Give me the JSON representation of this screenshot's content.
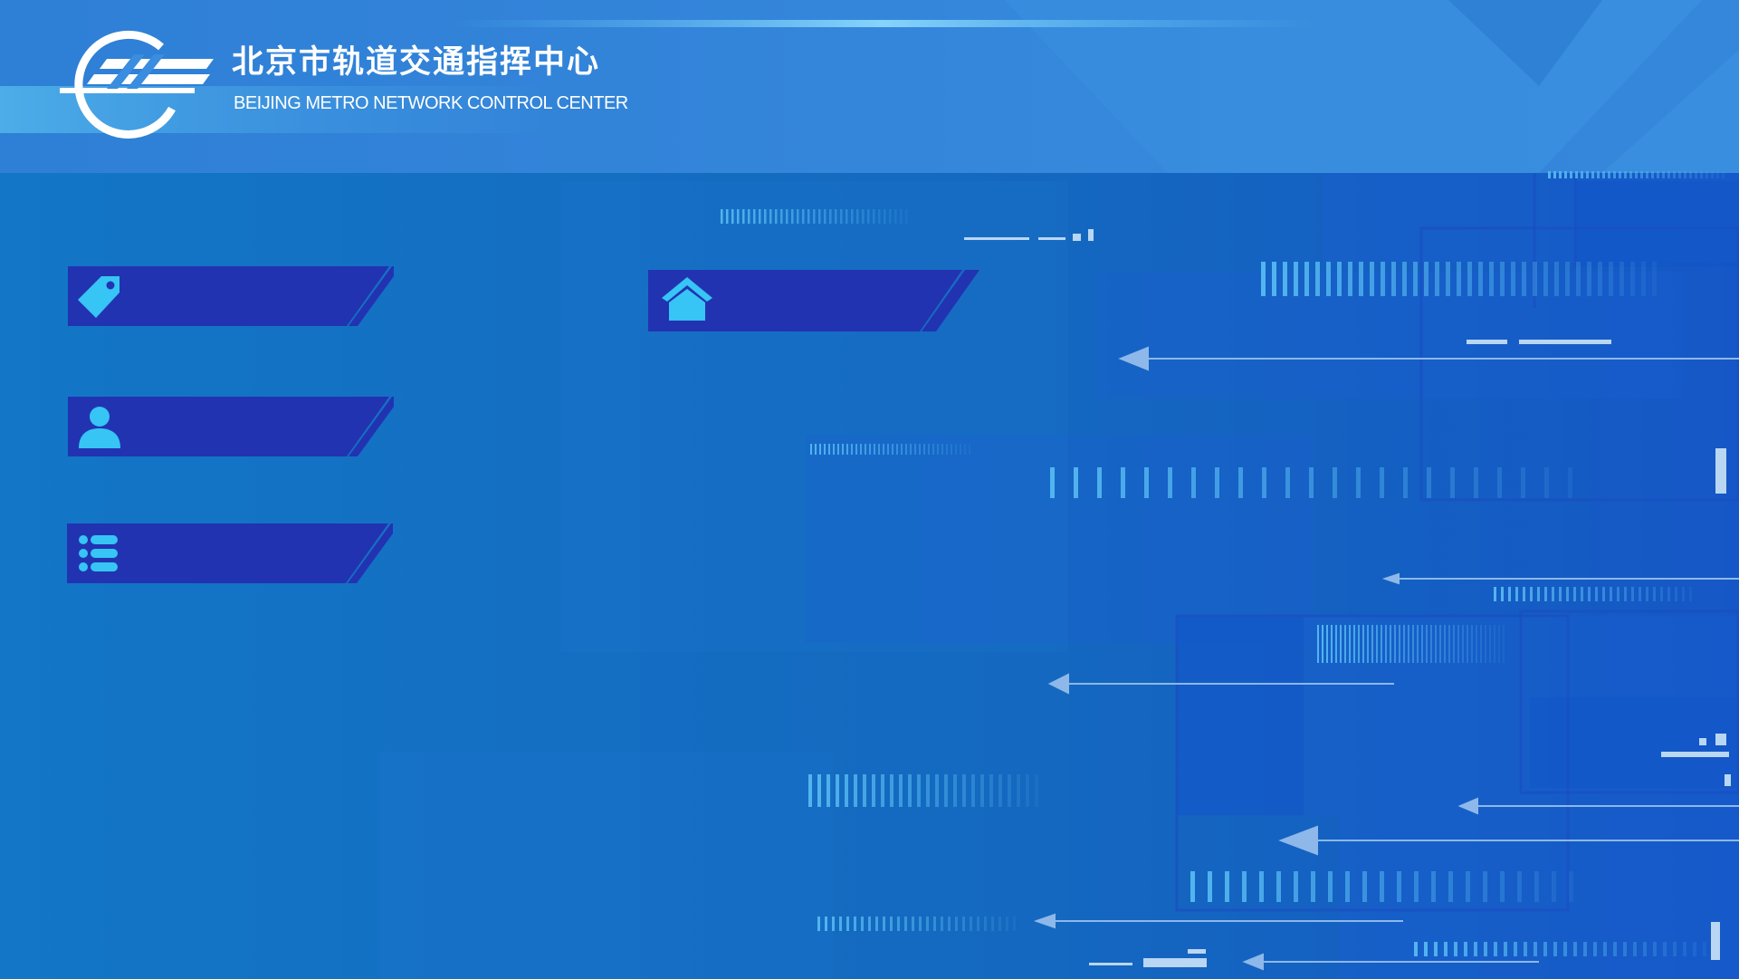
{
  "header": {
    "title_cn": "北京市轨道交通指挥中心",
    "title_en": "BEIJING METRO NETWORK CONTROL CENTER",
    "logo_icon": "metro-logo-icon"
  },
  "menu": [
    {
      "id": "tag",
      "icon": "tag-icon",
      "label": ""
    },
    {
      "id": "user",
      "icon": "user-icon",
      "label": ""
    },
    {
      "id": "list",
      "icon": "list-icon",
      "label": ""
    },
    {
      "id": "home",
      "icon": "home-icon",
      "label": ""
    }
  ],
  "colors": {
    "background": "#1373c4",
    "header_band": "#3585d8",
    "button_fill": "#2233b2",
    "icon_accent": "#36c5f5",
    "arrow": "#8fb9e8"
  }
}
